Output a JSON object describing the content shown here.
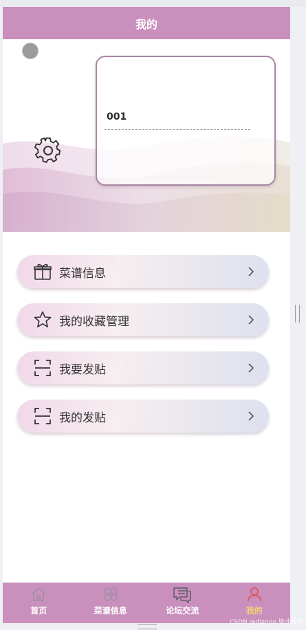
{
  "header": {
    "title": "我的"
  },
  "profile": {
    "username": "001"
  },
  "menu": {
    "items": [
      {
        "label": "菜谱信息",
        "icon": "gift-icon"
      },
      {
        "label": "我的收藏管理",
        "icon": "star-icon"
      },
      {
        "label": "我要发贴",
        "icon": "scan-icon"
      },
      {
        "label": "我的发贴",
        "icon": "scan-icon"
      }
    ]
  },
  "tabbar": {
    "items": [
      {
        "label": "首页",
        "icon": "home-icon"
      },
      {
        "label": "菜谱信息",
        "icon": "clover-icon"
      },
      {
        "label": "论坛交流",
        "icon": "chat-icon"
      },
      {
        "label": "我的",
        "icon": "user-icon",
        "active": true
      }
    ]
  },
  "watermark": "CSDN @django 毕业设计",
  "colors": {
    "brand": "#c98fbd",
    "active_tab": "#f2d27a",
    "active_icon": "#e0535f"
  }
}
